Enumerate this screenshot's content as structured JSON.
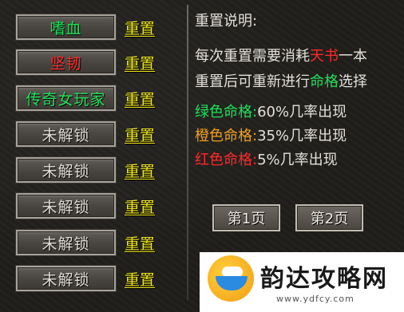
{
  "slots": [
    {
      "label": "嗜血",
      "color": "#1ee05a"
    },
    {
      "label": "坚韧",
      "color": "#ff2a2a"
    },
    {
      "label": "传奇女玩家",
      "color": "#1ee05a"
    },
    {
      "label": "未解锁",
      "color": "#e2ded6"
    },
    {
      "label": "未解锁",
      "color": "#e2ded6"
    },
    {
      "label": "未解锁",
      "color": "#e2ded6"
    },
    {
      "label": "未解锁",
      "color": "#e2ded6"
    },
    {
      "label": "未解锁",
      "color": "#e2ded6"
    }
  ],
  "reset_label": "重置",
  "info": {
    "title": "重置说明:",
    "line1": {
      "pre": "每次重置需要消耗",
      "item": "天书",
      "post": "一本"
    },
    "line2": {
      "pre": "重置后可重新进行",
      "item": "命格",
      "post": "选择"
    },
    "rates": [
      {
        "name": "绿色命格:",
        "value": "60%几率出现",
        "color": "#1ee05a"
      },
      {
        "name": "橙色命格:",
        "value": "35%几率出现",
        "color": "#f0a020"
      },
      {
        "name": "红色命格:",
        "value": "5%几率出现",
        "color": "#ff2a2a"
      }
    ]
  },
  "pages": {
    "page1": "第1页",
    "page2": "第2页"
  },
  "watermark": {
    "title": "韵达攻略网",
    "url": "www.ydfcy.com"
  }
}
